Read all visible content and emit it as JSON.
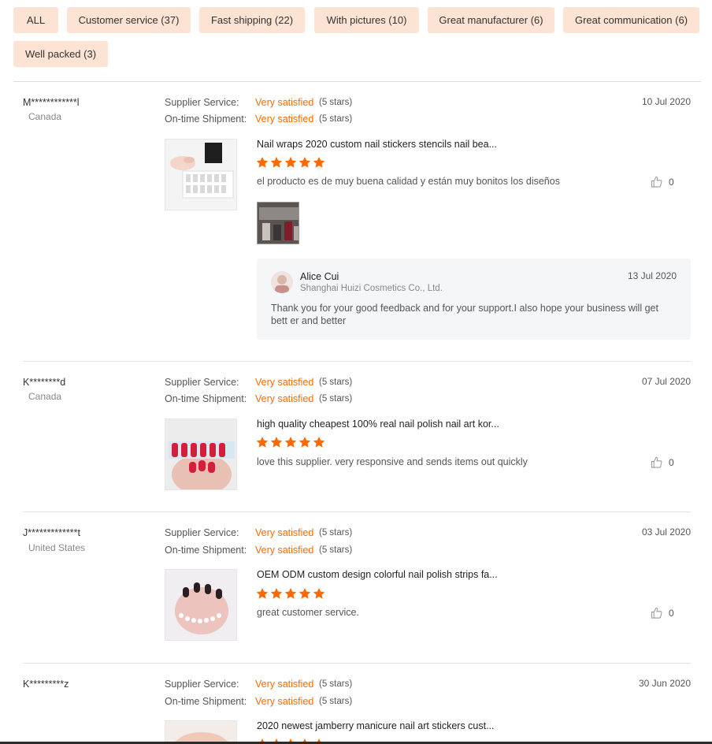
{
  "filters": [
    {
      "label": "ALL"
    },
    {
      "label": "Customer service (37)"
    },
    {
      "label": "Fast shipping (22)"
    },
    {
      "label": "With pictures (10)"
    },
    {
      "label": "Great manufacturer (6)"
    },
    {
      "label": "Great communication (6)"
    },
    {
      "label": "Well packed (3)"
    }
  ],
  "labels": {
    "supplier_service": "Supplier Service:",
    "ontime_shipment": "On-time Shipment:"
  },
  "colors": {
    "accent": "#ff6a00",
    "chip_bg": "#fde3d3"
  },
  "reviews": [
    {
      "buyer": "M************l",
      "country": "Canada",
      "date": "10 Jul 2020",
      "supplier_service": {
        "value": "Very satisfied",
        "stars_text": "(5 stars)"
      },
      "ontime_shipment": {
        "value": "Very satisfied",
        "stars_text": "(5 stars)"
      },
      "product_title": "Nail wraps 2020 custom nail stickers stencils nail bea...",
      "rating": 5,
      "comment": "el producto es de muy buena calidad y están muy bonitos los diseños",
      "likes": "0",
      "reply": {
        "name": "Alice Cui",
        "company": "Shanghai Huizi Cosmetics Co., Ltd.",
        "date": "13 Jul 2020",
        "text": "Thank you for your good feedback and for your support.I also hope your business will get bett er and better"
      }
    },
    {
      "buyer": "K********d",
      "country": "Canada",
      "date": "07 Jul 2020",
      "supplier_service": {
        "value": "Very satisfied",
        "stars_text": "(5 stars)"
      },
      "ontime_shipment": {
        "value": "Very satisfied",
        "stars_text": "(5 stars)"
      },
      "product_title": "high quality cheapest 100% real nail polish nail art kor...",
      "rating": 5,
      "comment": "love this supplier. very responsive and sends items out quickly",
      "likes": "0"
    },
    {
      "buyer": "J*************t",
      "country": "United States",
      "date": "03 Jul 2020",
      "supplier_service": {
        "value": "Very satisfied",
        "stars_text": "(5 stars)"
      },
      "ontime_shipment": {
        "value": "Very satisfied",
        "stars_text": "(5 stars)"
      },
      "product_title": "OEM ODM custom design colorful nail polish strips fa...",
      "rating": 5,
      "comment": "great customer service.",
      "likes": "0"
    },
    {
      "buyer": "K*********z",
      "date": "30 Jun 2020",
      "supplier_service": {
        "value": "Very satisfied",
        "stars_text": "(5 stars)"
      },
      "ontime_shipment": {
        "value": "Very satisfied",
        "stars_text": "(5 stars)"
      },
      "product_title": "2020 newest jamberry manicure nail art stickers cust...",
      "rating": 5
    }
  ]
}
